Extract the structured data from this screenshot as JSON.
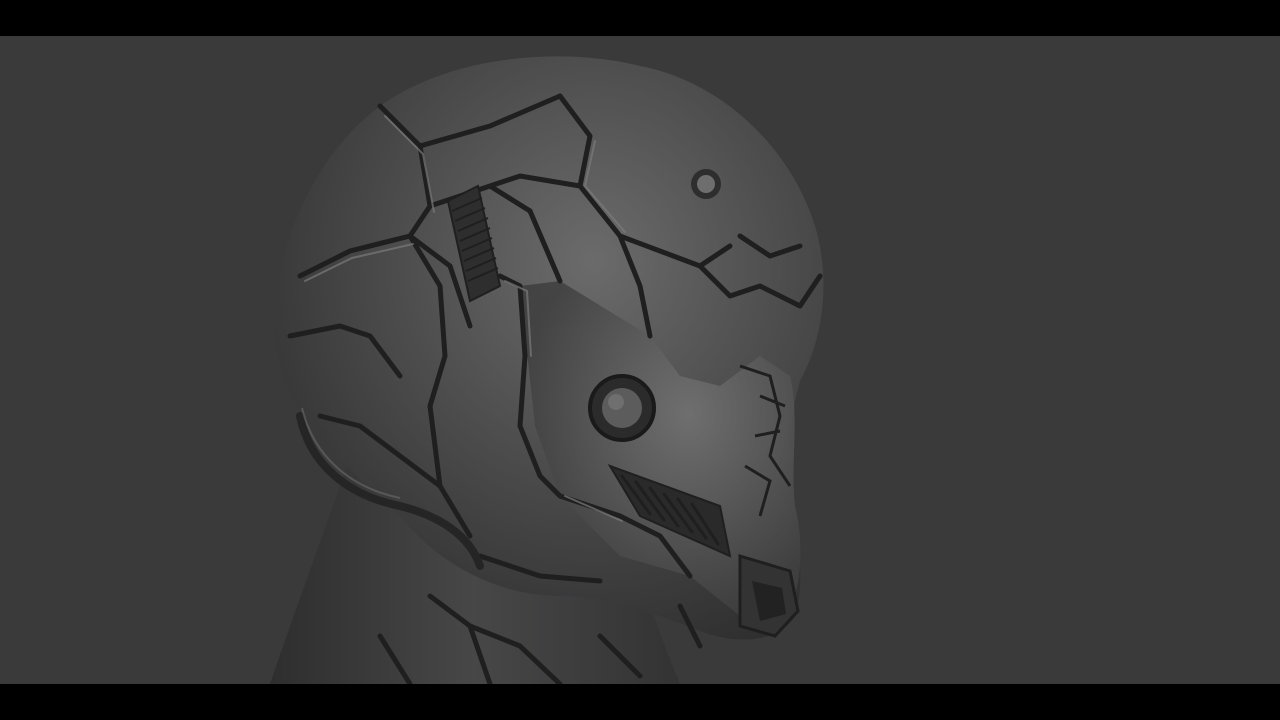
{
  "scene": {
    "subject_icon": "sculpted-helmet-head",
    "colors": {
      "letterbox": "#000000",
      "background": "#3a3a3b",
      "surface": "#4a4a4b",
      "surface_light": "#6a6a6b",
      "surface_dark": "#2a2a2b",
      "groove": "#1f1f20"
    }
  }
}
